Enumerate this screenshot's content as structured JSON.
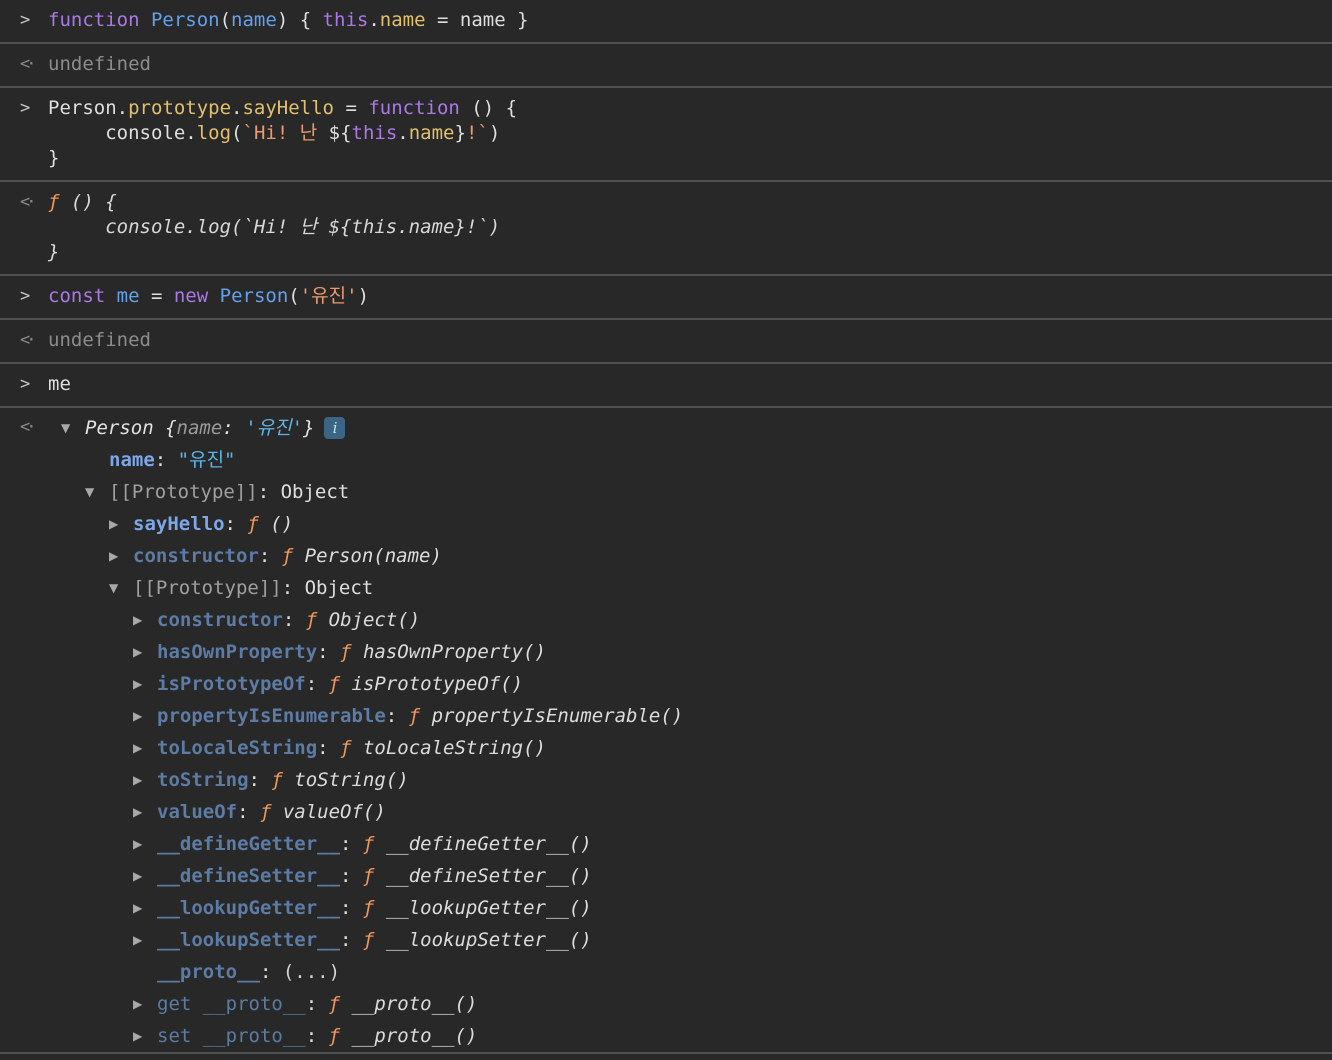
{
  "app": "devtools-console",
  "theme": {
    "background": "#282828",
    "divider": "#505050",
    "keyword_color": "#AB78E8",
    "definition_color": "#64A1EC",
    "property_color": "#E2C06E",
    "string_input_color": "#EC9A6E",
    "string_value_color": "#5CB5E8",
    "enumerable_key_color": "#7DA7E8",
    "non_enumerable_key_color": "#5C7BA5",
    "function_f_color": "#F2975A",
    "muted_color": "#8C8C8C",
    "info_badge_bg": "#3A6584"
  },
  "icons": {
    "input_chevron": ">",
    "output_chevron": "<·",
    "expanded": "▼",
    "collapsed": "▶",
    "info": "i"
  },
  "console": {
    "entries": [
      {
        "kind": "input",
        "lines": [
          [
            {
              "t": "function ",
              "c": "kw"
            },
            {
              "t": "Person",
              "c": "def"
            },
            {
              "t": "(",
              "c": "plain"
            },
            {
              "t": "name",
              "c": "def"
            },
            {
              "t": ") { ",
              "c": "plain"
            },
            {
              "t": "this",
              "c": "kw"
            },
            {
              "t": ".",
              "c": "plain"
            },
            {
              "t": "name",
              "c": "prop"
            },
            {
              "t": " = name }",
              "c": "plain"
            }
          ]
        ]
      },
      {
        "kind": "result",
        "lines": [
          [
            {
              "t": "undefined",
              "c": "muted"
            }
          ]
        ]
      },
      {
        "kind": "input",
        "lines": [
          [
            {
              "t": "Person.",
              "c": "plain"
            },
            {
              "t": "prototype",
              "c": "prop"
            },
            {
              "t": ".",
              "c": "plain"
            },
            {
              "t": "sayHello",
              "c": "prop"
            },
            {
              "t": " = ",
              "c": "plain"
            },
            {
              "t": "function",
              "c": "kw"
            },
            {
              "t": " () {",
              "c": "plain"
            }
          ],
          [
            {
              "t": "     console.",
              "c": "plain"
            },
            {
              "t": "log",
              "c": "prop"
            },
            {
              "t": "(",
              "c": "plain"
            },
            {
              "t": "`Hi! 난 ",
              "c": "str"
            },
            {
              "t": "${",
              "c": "plain"
            },
            {
              "t": "this",
              "c": "kw"
            },
            {
              "t": ".",
              "c": "plain"
            },
            {
              "t": "name",
              "c": "prop"
            },
            {
              "t": "}",
              "c": "plain"
            },
            {
              "t": "!`",
              "c": "str"
            },
            {
              "t": ")",
              "c": "plain"
            }
          ],
          [
            {
              "t": "}",
              "c": "plain"
            }
          ]
        ]
      },
      {
        "kind": "result",
        "lines": [
          [
            {
              "t": "ƒ ",
              "c": "fnf"
            },
            {
              "t": "() {",
              "c": "res"
            }
          ],
          [
            {
              "t": "     console.log(`Hi! 난 ${this.name}!`)",
              "c": "res"
            }
          ],
          [
            {
              "t": "}",
              "c": "res"
            }
          ]
        ]
      },
      {
        "kind": "input",
        "lines": [
          [
            {
              "t": "const ",
              "c": "kw"
            },
            {
              "t": "me",
              "c": "def"
            },
            {
              "t": " = ",
              "c": "plain"
            },
            {
              "t": "new ",
              "c": "kw"
            },
            {
              "t": "Person",
              "c": "def"
            },
            {
              "t": "(",
              "c": "plain"
            },
            {
              "t": "'유진'",
              "c": "str"
            },
            {
              "t": ")",
              "c": "plain"
            }
          ]
        ]
      },
      {
        "kind": "result",
        "lines": [
          [
            {
              "t": "undefined",
              "c": "muted"
            }
          ]
        ]
      },
      {
        "kind": "input",
        "lines": [
          [
            {
              "t": "me",
              "c": "plain"
            }
          ]
        ]
      },
      {
        "kind": "tree",
        "rows": [
          {
            "indent": 0,
            "twisty": "open",
            "badge": true,
            "tokens": [
              {
                "t": "Person",
                "c": "obj"
              },
              {
                "t": " {",
                "c": "obj"
              },
              {
                "t": "name",
                "c": "pkey"
              },
              {
                "t": ": ",
                "c": "obj"
              },
              {
                "t": "'유진'",
                "c": "pstr"
              },
              {
                "t": "}",
                "c": "obj"
              }
            ]
          },
          {
            "indent": 1,
            "twisty": "none",
            "tokens": [
              {
                "t": "name",
                "c": "key"
              },
              {
                "t": ": ",
                "c": "plain"
              },
              {
                "t": "\"유진\"",
                "c": "strval"
              }
            ]
          },
          {
            "indent": 1,
            "twisty": "open",
            "tokens": [
              {
                "t": "[[Prototype]]",
                "c": "meta"
              },
              {
                "t": ": ",
                "c": "plain"
              },
              {
                "t": "Object",
                "c": "plain"
              }
            ]
          },
          {
            "indent": 2,
            "twisty": "closed",
            "tokens": [
              {
                "t": "sayHello",
                "c": "key"
              },
              {
                "t": ": ",
                "c": "plain"
              },
              {
                "t": "ƒ ",
                "c": "fnf"
              },
              {
                "t": "()",
                "c": "sig"
              }
            ]
          },
          {
            "indent": 2,
            "twisty": "closed",
            "tokens": [
              {
                "t": "constructor",
                "c": "dimkey"
              },
              {
                "t": ": ",
                "c": "plain"
              },
              {
                "t": "ƒ ",
                "c": "fnf"
              },
              {
                "t": "Person(name)",
                "c": "sig"
              }
            ]
          },
          {
            "indent": 2,
            "twisty": "open",
            "tokens": [
              {
                "t": "[[Prototype]]",
                "c": "meta"
              },
              {
                "t": ": ",
                "c": "plain"
              },
              {
                "t": "Object",
                "c": "plain"
              }
            ]
          },
          {
            "indent": 3,
            "twisty": "closed",
            "tokens": [
              {
                "t": "constructor",
                "c": "dimkey"
              },
              {
                "t": ": ",
                "c": "plain"
              },
              {
                "t": "ƒ ",
                "c": "fnf"
              },
              {
                "t": "Object()",
                "c": "sig"
              }
            ]
          },
          {
            "indent": 3,
            "twisty": "closed",
            "tokens": [
              {
                "t": "hasOwnProperty",
                "c": "dimkey"
              },
              {
                "t": ": ",
                "c": "plain"
              },
              {
                "t": "ƒ ",
                "c": "fnf"
              },
              {
                "t": "hasOwnProperty()",
                "c": "sig"
              }
            ]
          },
          {
            "indent": 3,
            "twisty": "closed",
            "tokens": [
              {
                "t": "isPrototypeOf",
                "c": "dimkey"
              },
              {
                "t": ": ",
                "c": "plain"
              },
              {
                "t": "ƒ ",
                "c": "fnf"
              },
              {
                "t": "isPrototypeOf()",
                "c": "sig"
              }
            ]
          },
          {
            "indent": 3,
            "twisty": "closed",
            "tokens": [
              {
                "t": "propertyIsEnumerable",
                "c": "dimkey"
              },
              {
                "t": ": ",
                "c": "plain"
              },
              {
                "t": "ƒ ",
                "c": "fnf"
              },
              {
                "t": "propertyIsEnumerable()",
                "c": "sig"
              }
            ]
          },
          {
            "indent": 3,
            "twisty": "closed",
            "tokens": [
              {
                "t": "toLocaleString",
                "c": "dimkey"
              },
              {
                "t": ": ",
                "c": "plain"
              },
              {
                "t": "ƒ ",
                "c": "fnf"
              },
              {
                "t": "toLocaleString()",
                "c": "sig"
              }
            ]
          },
          {
            "indent": 3,
            "twisty": "closed",
            "tokens": [
              {
                "t": "toString",
                "c": "dimkey"
              },
              {
                "t": ": ",
                "c": "plain"
              },
              {
                "t": "ƒ ",
                "c": "fnf"
              },
              {
                "t": "toString()",
                "c": "sig"
              }
            ]
          },
          {
            "indent": 3,
            "twisty": "closed",
            "tokens": [
              {
                "t": "valueOf",
                "c": "dimkey"
              },
              {
                "t": ": ",
                "c": "plain"
              },
              {
                "t": "ƒ ",
                "c": "fnf"
              },
              {
                "t": "valueOf()",
                "c": "sig"
              }
            ]
          },
          {
            "indent": 3,
            "twisty": "closed",
            "tokens": [
              {
                "t": "__defineGetter__",
                "c": "dimkey"
              },
              {
                "t": ": ",
                "c": "plain"
              },
              {
                "t": "ƒ ",
                "c": "fnf"
              },
              {
                "t": "__defineGetter__()",
                "c": "sig"
              }
            ]
          },
          {
            "indent": 3,
            "twisty": "closed",
            "tokens": [
              {
                "t": "__defineSetter__",
                "c": "dimkey"
              },
              {
                "t": ": ",
                "c": "plain"
              },
              {
                "t": "ƒ ",
                "c": "fnf"
              },
              {
                "t": "__defineSetter__()",
                "c": "sig"
              }
            ]
          },
          {
            "indent": 3,
            "twisty": "closed",
            "tokens": [
              {
                "t": "__lookupGetter__",
                "c": "dimkey"
              },
              {
                "t": ": ",
                "c": "plain"
              },
              {
                "t": "ƒ ",
                "c": "fnf"
              },
              {
                "t": "__lookupGetter__()",
                "c": "sig"
              }
            ]
          },
          {
            "indent": 3,
            "twisty": "closed",
            "tokens": [
              {
                "t": "__lookupSetter__",
                "c": "dimkey"
              },
              {
                "t": ": ",
                "c": "plain"
              },
              {
                "t": "ƒ ",
                "c": "fnf"
              },
              {
                "t": "__lookupSetter__()",
                "c": "sig"
              }
            ]
          },
          {
            "indent": 3,
            "twisty": "none",
            "tokens": [
              {
                "t": "__proto__",
                "c": "dimkey"
              },
              {
                "t": ": ",
                "c": "plain"
              },
              {
                "t": "(...)",
                "c": "eval"
              }
            ]
          },
          {
            "indent": 3,
            "twisty": "closed",
            "tokens": [
              {
                "t": "get __proto__",
                "c": "dimkey2"
              },
              {
                "t": ": ",
                "c": "plain"
              },
              {
                "t": "ƒ ",
                "c": "fnf"
              },
              {
                "t": "__proto__()",
                "c": "sig"
              }
            ]
          },
          {
            "indent": 3,
            "twisty": "closed",
            "tokens": [
              {
                "t": "set __proto__",
                "c": "dimkey2"
              },
              {
                "t": ": ",
                "c": "plain"
              },
              {
                "t": "ƒ ",
                "c": "fnf"
              },
              {
                "t": "__proto__()",
                "c": "sig"
              }
            ]
          }
        ]
      }
    ]
  }
}
